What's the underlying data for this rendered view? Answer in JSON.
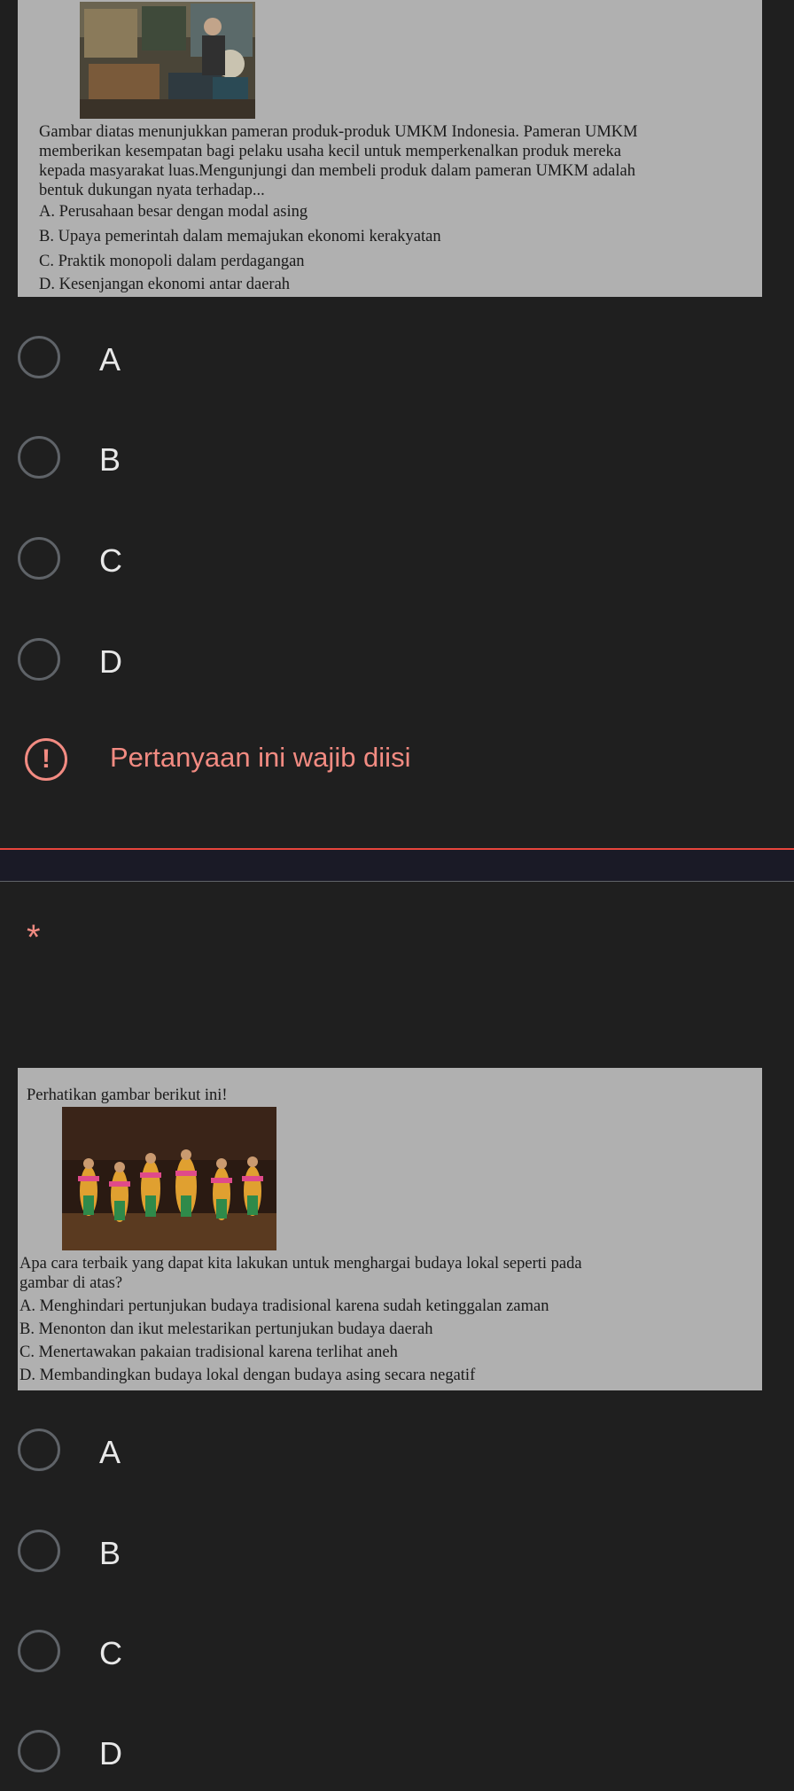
{
  "question1": {
    "text_lines": [
      "Gambar diatas menunjukkan pameran produk-produk UMKM Indonesia. Pameran UMKM",
      "memberikan kesempatan bagi pelaku usaha kecil untuk memperkenalkan produk mereka",
      "kepada masyarakat luas.Mengunjungi dan membeli produk dalam pameran UMKM adalah",
      "bentuk dukungan nyata terhadap..."
    ],
    "choices": [
      "A.  Perusahaan besar dengan modal asing",
      "B.  Upaya pemerintah dalam memajukan ekonomi kerakyatan",
      "C.  Praktik monopoli dalam perdagangan",
      "D.  Kesenjangan ekonomi antar daerah"
    ],
    "options": [
      "A",
      "B",
      "C",
      "D"
    ],
    "error": "Pertanyaan ini wajib diisi"
  },
  "question2": {
    "required_marker": "*",
    "intro": "Perhatikan gambar berikut ini!",
    "text_lines": [
      "Apa cara terbaik yang dapat kita lakukan untuk menghargai budaya lokal seperti pada",
      "gambar di atas?"
    ],
    "choices": [
      "A.  Menghindari pertunjukan budaya tradisional karena sudah ketinggalan zaman",
      "B. Menonton dan ikut melestarikan pertunjukan budaya daerah",
      "C. Menertawakan pakaian tradisional karena terlihat aneh",
      "D. Membandingkan budaya lokal dengan budaya asing secara negatif"
    ],
    "options": [
      "A",
      "B",
      "C",
      "D"
    ]
  },
  "colors": {
    "background": "#1f1f1f",
    "error": "#f28b82",
    "divider": "#e8453c"
  }
}
